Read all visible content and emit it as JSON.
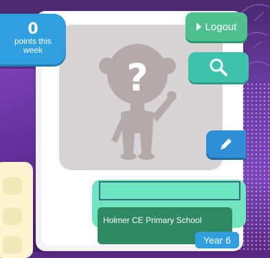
{
  "points": {
    "value": "0",
    "label": "points this week"
  },
  "buttons": {
    "logout_label": "Logout",
    "search_icon": "magnifier-icon",
    "edit_icon": "pencil-icon"
  },
  "profile": {
    "avatar_icon": "mystery-person-icon",
    "name_value": "",
    "school": "Holmer CE Primary School",
    "year": "Year 6"
  },
  "colors": {
    "points_blue": "#2f9fe0",
    "logout_green": "#4fc08f",
    "search_teal": "#3fc2ad",
    "edit_blue": "#2f8fd6",
    "name_mint": "#6fe4bf",
    "school_green": "#2f8a63",
    "background_purple": "#5a2a82"
  }
}
